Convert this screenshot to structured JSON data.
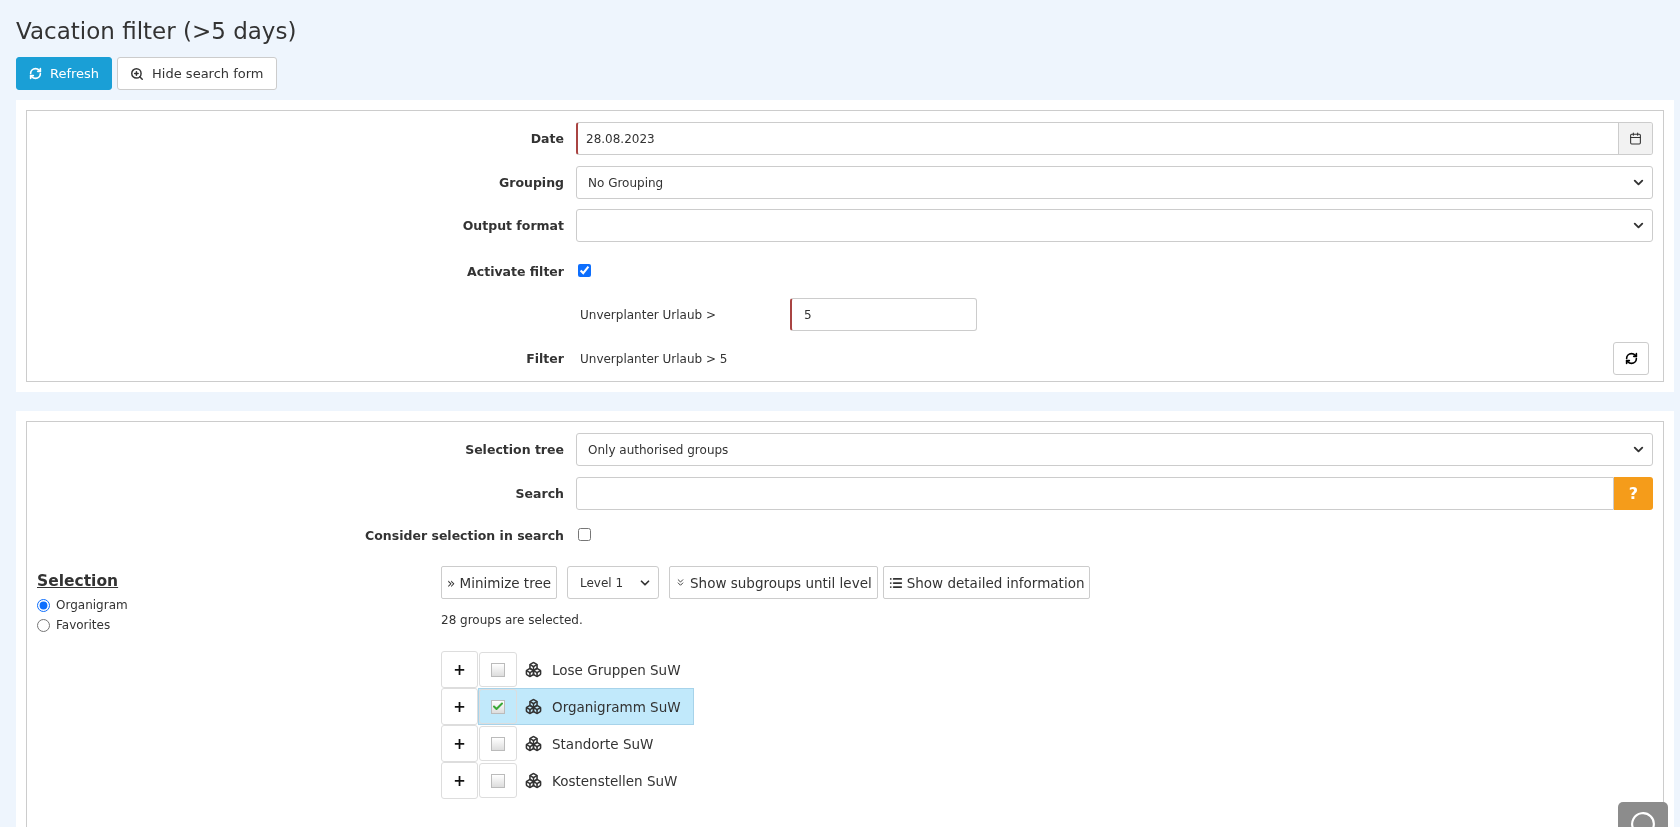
{
  "title": "Vacation filter (>5 days)",
  "toolbar": [
    {
      "label": "Refresh",
      "kind": "primary"
    },
    {
      "label": "Hide search form",
      "kind": "default"
    }
  ],
  "filter_form": {
    "date": {
      "label": "Date",
      "value": "28.08.2023"
    },
    "grouping": {
      "label": "Grouping",
      "value": "No Grouping"
    },
    "output_format": {
      "label": "Output format"
    },
    "activate_filter": {
      "label": "Activate filter",
      "checked": true
    },
    "condition": {
      "label": "Unverplanter Urlaub >",
      "value": "5"
    },
    "filter": {
      "label": "Filter",
      "value": "Unverplanter Urlaub > 5"
    }
  },
  "selection_form": {
    "selection_tree": {
      "label": "Selection tree",
      "value": "Only authorised groups"
    },
    "search": {
      "label": "Search",
      "help": "?"
    },
    "consider_selection": {
      "label": "Consider selection in search",
      "checked": false
    }
  },
  "selection": {
    "heading": "Selection",
    "options": [
      {
        "label": "Organigram",
        "selected": true
      },
      {
        "label": "Favorites",
        "selected": false
      }
    ]
  },
  "tree_toolbar": {
    "minimize": "» Minimize tree",
    "level": "Level 1",
    "subgroups": "Show subgroups until level",
    "details": "Show detailed information"
  },
  "status": "28 groups are selected.",
  "tree": [
    {
      "label": "Lose Gruppen SuW",
      "expander": "+",
      "checked": false,
      "selected": false
    },
    {
      "label": "Organigramm SuW",
      "expander": "+",
      "checked": true,
      "selected": true
    },
    {
      "label": "Standorte SuW",
      "expander": "+",
      "checked": false,
      "selected": false
    },
    {
      "label": "Kostenstellen SuW",
      "expander": "+",
      "checked": false,
      "selected": false
    }
  ]
}
